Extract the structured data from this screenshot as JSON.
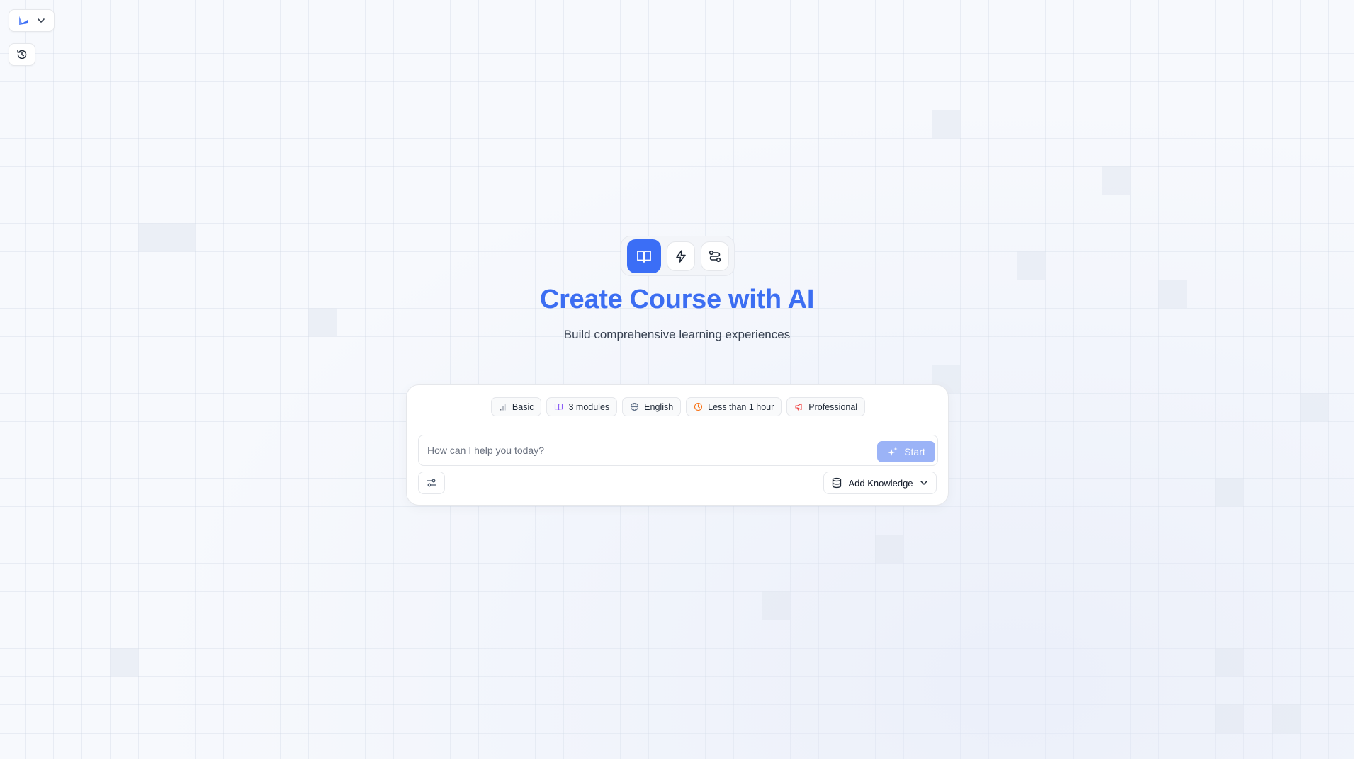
{
  "app": {
    "brand_icon": "logo-icon",
    "colors": {
      "accent": "#3b6ef6",
      "title": "#3c6ef2",
      "start_disabled": "#9bb3f7"
    }
  },
  "header": {
    "brand_switch_icon": "chevron-down-icon",
    "history_icon": "history-icon"
  },
  "modes": [
    {
      "name": "course",
      "icon": "book-open-icon",
      "active": true
    },
    {
      "name": "quick",
      "icon": "lightning-icon",
      "active": false
    },
    {
      "name": "workflow",
      "icon": "route-icon",
      "active": false
    }
  ],
  "hero": {
    "title": "Create Course with AI",
    "subtitle": "Build comprehensive learning experiences"
  },
  "options": [
    {
      "label": "Basic",
      "icon": "bar-chart-icon"
    },
    {
      "label": "3 modules",
      "icon": "book-icon"
    },
    {
      "label": "English",
      "icon": "globe-icon"
    },
    {
      "label": "Less than 1 hour",
      "icon": "clock-icon"
    },
    {
      "label": "Professional",
      "icon": "megaphone-icon"
    }
  ],
  "prompt": {
    "placeholder": "How can I help you today?",
    "value": "",
    "start_label": "Start"
  },
  "knowledge": {
    "label": "Add Knowledge"
  }
}
